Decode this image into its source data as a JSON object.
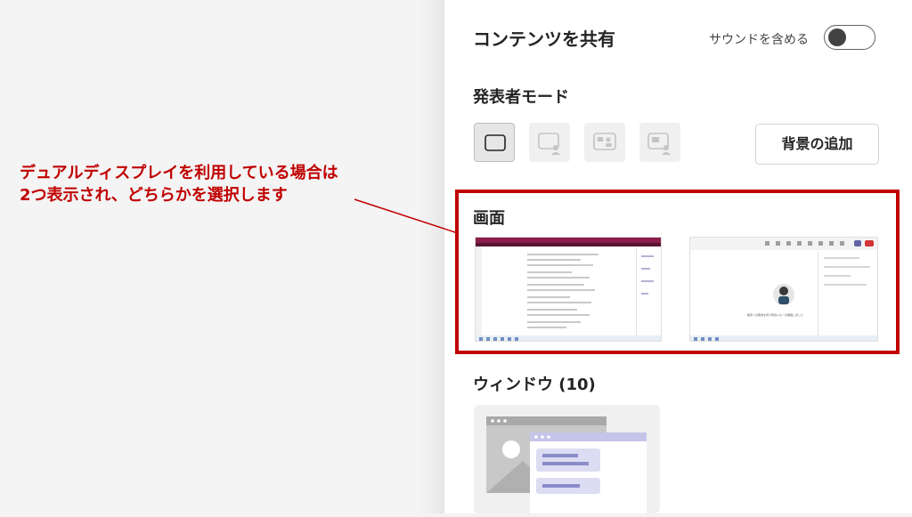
{
  "panel": {
    "title": "コンテンツを共有",
    "sound_label": "サウンドを含める",
    "sound_toggle_on": false
  },
  "presenter_mode": {
    "title": "発表者モード",
    "modes": [
      "content-only",
      "standout",
      "side-by-side",
      "reporter"
    ],
    "selected": "content-only",
    "add_background_label": "背景の追加"
  },
  "screens": {
    "title": "画面",
    "thumb_1_caption": "",
    "thumb_2_caption": "相手への発言を待つ待合いもーが開始しました"
  },
  "windows": {
    "title": "ウィンドウ (10)"
  },
  "annotation": {
    "line1": "デュアルディスプレイを利用している場合は",
    "line2": "2つ表示され、どちらかを選択します"
  },
  "colors": {
    "annotation_red": "#c00000",
    "accent_purple": "#6264a7",
    "title_bar_magenta": "#8b1e4a"
  }
}
